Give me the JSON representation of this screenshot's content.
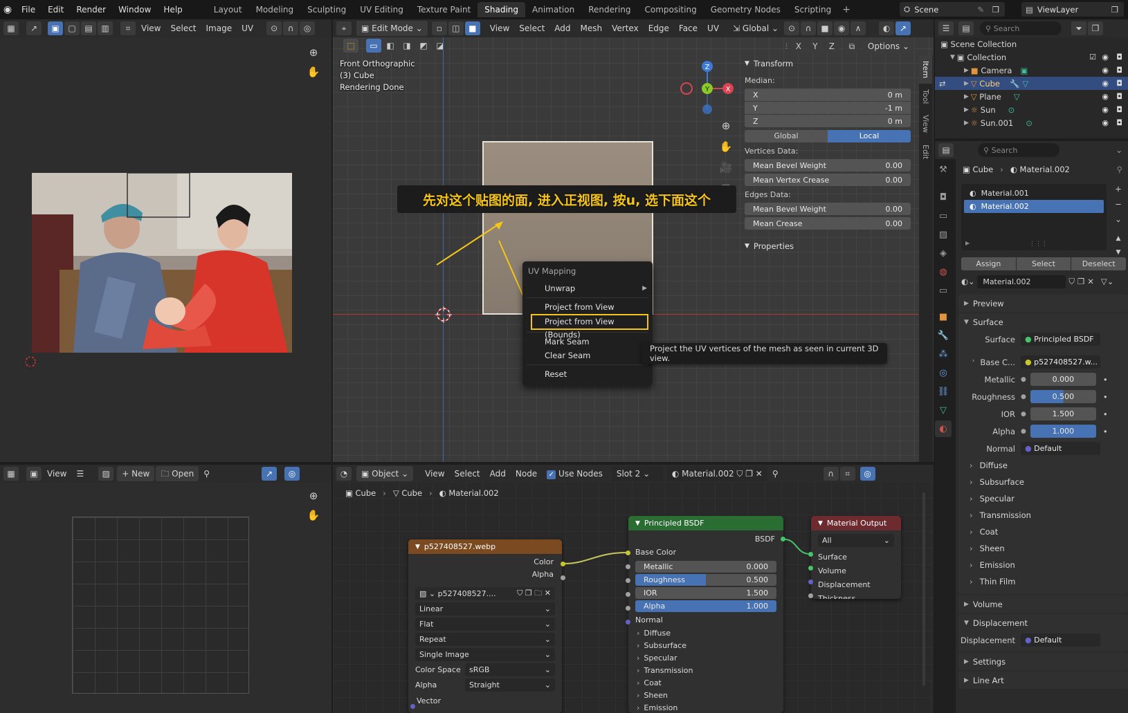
{
  "topbar": {
    "menus": [
      "File",
      "Edit",
      "Render",
      "Window",
      "Help"
    ],
    "workspaces": [
      "Layout",
      "Modeling",
      "Sculpting",
      "UV Editing",
      "Texture Paint",
      "Shading",
      "Animation",
      "Rendering",
      "Compositing",
      "Geometry Nodes",
      "Scripting"
    ],
    "active_workspace": "Shading",
    "scene": "Scene",
    "view_layer": "ViewLayer"
  },
  "image_editor_top": {
    "menus": [
      "View",
      "Select",
      "Image",
      "UV"
    ]
  },
  "viewport": {
    "mode": "Edit Mode",
    "menus": [
      "View",
      "Select",
      "Add",
      "Mesh",
      "Vertex",
      "Edge",
      "Face",
      "UV"
    ],
    "orientation": "Global",
    "options_label": "Options",
    "overlay_lines": [
      "Front Orthographic",
      "(3) Cube",
      "Rendering Done"
    ],
    "axis_labels": [
      "X",
      "Y",
      "Z"
    ],
    "annotation": "先对这个贴图的面, 进入正视图, 按u, 选下面这个",
    "vertical_tabs": [
      "Item",
      "Tool",
      "View",
      "Edit"
    ]
  },
  "transform_panel": {
    "title": "Transform",
    "median_label": "Median:",
    "fields": [
      {
        "label": "X",
        "value": "0 m"
      },
      {
        "label": "Y",
        "value": "-1 m"
      },
      {
        "label": "Z",
        "value": "0 m"
      }
    ],
    "toggle": [
      "Global",
      "Local"
    ],
    "vertices_label": "Vertices Data:",
    "vertices_fields": [
      {
        "label": "Mean Bevel Weight",
        "value": "0.00"
      },
      {
        "label": "Mean Vertex Crease",
        "value": "0.00"
      }
    ],
    "edges_label": "Edges Data:",
    "edges_fields": [
      {
        "label": "Mean Bevel Weight",
        "value": "0.00"
      },
      {
        "label": "Mean Crease",
        "value": "0.00"
      }
    ],
    "properties_title": "Properties"
  },
  "context_menu": {
    "title": "UV Mapping",
    "items": [
      "Unwrap",
      "Project from View",
      "Project from View (Bounds)",
      "Mark Seam",
      "Clear Seam",
      "Reset"
    ],
    "highlighted": "Project from View (Bounds)",
    "tooltip": "Project the UV vertices of the mesh as seen in current 3D view."
  },
  "outliner": {
    "search_placeholder": "Search",
    "items": [
      {
        "name": "Scene Collection",
        "depth": 0
      },
      {
        "name": "Collection",
        "depth": 1
      },
      {
        "name": "Camera",
        "depth": 2
      },
      {
        "name": "Cube",
        "depth": 2
      },
      {
        "name": "Plane",
        "depth": 2
      },
      {
        "name": "Sun",
        "depth": 2
      },
      {
        "name": "Sun.001",
        "depth": 2
      }
    ],
    "selected": "Cube"
  },
  "properties": {
    "search_placeholder": "Search",
    "breadcrumb": [
      "Cube",
      "Material.002"
    ],
    "slots": [
      "Material.001",
      "Material.002"
    ],
    "selected_slot": "Material.002",
    "slot_buttons": [
      "Assign",
      "Select",
      "Deselect"
    ],
    "material_name": "Material.002",
    "sections": {
      "preview": "Preview",
      "surface": "Surface",
      "volume": "Volume",
      "displacement": "Displacement",
      "settings": "Settings",
      "line_art": "Line Art"
    },
    "surface_label": "Surface",
    "surface_value": "Principled BSDF",
    "base_color_label": "Base C...",
    "base_color_value": "p527408527.w...",
    "params": [
      {
        "label": "Metallic",
        "value": "0.000",
        "blue": false
      },
      {
        "label": "Roughness",
        "value": "0.500",
        "blue": true,
        "fill": 0.5
      },
      {
        "label": "IOR",
        "value": "1.500",
        "blue": false
      },
      {
        "label": "Alpha",
        "value": "1.000",
        "blue": true,
        "fill": 1.0
      }
    ],
    "normal_label": "Normal",
    "normal_value": "Default",
    "subsections": [
      "Diffuse",
      "Subsurface",
      "Specular",
      "Transmission",
      "Coat",
      "Sheen",
      "Emission",
      "Thin Film"
    ],
    "displacement_label": "Displacement",
    "displacement_value": "Default"
  },
  "image_editor_bottom": {
    "view_label": "View",
    "new_label": "New",
    "open_label": "Open"
  },
  "node_editor": {
    "object_label": "Object",
    "menus": [
      "View",
      "Select",
      "Add",
      "Node"
    ],
    "use_nodes": "Use Nodes",
    "slot": "Slot 2",
    "material": "Material.002",
    "breadcrumb": [
      "Cube",
      "Cube",
      "Material.002"
    ],
    "image_node": {
      "title": "p527408527.webp",
      "outputs": [
        "Color",
        "Alpha"
      ],
      "image_name": "p527408527....",
      "dropdowns": [
        "Linear",
        "Flat",
        "Repeat",
        "Single Image"
      ],
      "color_space_label": "Color Space",
      "color_space": "sRGB",
      "alpha_label": "Alpha",
      "alpha": "Straight",
      "vector": "Vector"
    },
    "bsdf_node": {
      "title": "Principled BSDF",
      "output": "BSDF",
      "base_color": "Base Color",
      "params": [
        {
          "label": "Metallic",
          "value": "0.000"
        },
        {
          "label": "Roughness",
          "value": "0.500"
        },
        {
          "label": "IOR",
          "value": "1.500"
        },
        {
          "label": "Alpha",
          "value": "1.000"
        }
      ],
      "normal": "Normal",
      "subsections": [
        "Diffuse",
        "Subsurface",
        "Specular",
        "Transmission",
        "Coat",
        "Sheen",
        "Emission"
      ]
    },
    "output_node": {
      "title": "Material Output",
      "target": "All",
      "inputs": [
        "Surface",
        "Volume",
        "Displacement",
        "Thickness"
      ]
    }
  },
  "colors": {
    "accent_blue": "#4772b3",
    "highlight_yellow": "#f5c518",
    "shader_green": "#2a6d32",
    "texture_orange": "#7b4a20",
    "output_red": "#6d2a2f"
  }
}
